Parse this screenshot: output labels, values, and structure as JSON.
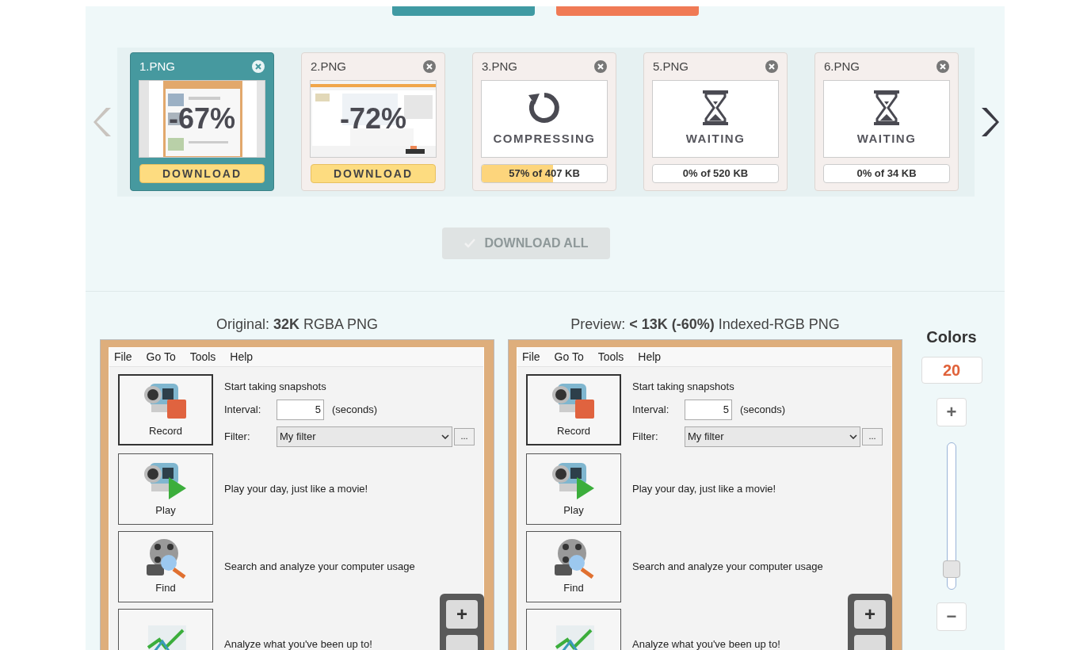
{
  "carousel": {
    "files": [
      {
        "name": "1.PNG",
        "kind": "done",
        "selected": true,
        "saving": "-67%",
        "action": "DOWNLOAD"
      },
      {
        "name": "2.PNG",
        "kind": "done",
        "selected": false,
        "saving": "-72%",
        "action": "DOWNLOAD"
      },
      {
        "name": "3.PNG",
        "kind": "compressing",
        "selected": false,
        "status": "COMPRESSING",
        "progress": "57% of 407 KB",
        "level": 0.57
      },
      {
        "name": "5.PNG",
        "kind": "waiting",
        "selected": false,
        "status": "WAITING",
        "progress": "0% of 520 KB",
        "level": 0
      },
      {
        "name": "6.PNG",
        "kind": "waiting",
        "selected": false,
        "status": "WAITING",
        "progress": "0% of 34 KB",
        "level": 0
      }
    ]
  },
  "download_all": {
    "label": "DOWNLOAD ALL",
    "disabled": true
  },
  "panes": [
    {
      "caption": "Original: **32K** RGBA PNG",
      "zoom_in": "+",
      "app": {
        "menu": [
          "File",
          "Go To",
          "Tools",
          "Help"
        ],
        "tools": [
          {
            "kind": "record",
            "label": "Record",
            "text": "Start taking snapshots"
          },
          {
            "kind": "play",
            "label": "Play",
            "text": "Play your day, just like a movie!"
          },
          {
            "kind": "find",
            "label": "Find",
            "text": "Search and analyze your computer usage"
          },
          {
            "kind": "chart",
            "text": "Analyze what you've been up to!"
          }
        ],
        "interval": {
          "label": "Interval:",
          "value": "5",
          "unit": "(seconds)"
        },
        "filter": {
          "label": "Filter:",
          "value": "My filter",
          "more": "..."
        }
      }
    },
    {
      "caption": "Preview: **< 13K (-60%)** Indexed-RGB PNG",
      "zoom_in": "+",
      "app": {
        "menu": [
          "File",
          "Go To",
          "Tools",
          "Help"
        ],
        "tools": [
          {
            "kind": "record",
            "label": "Record",
            "text": "Start taking snapshots"
          },
          {
            "kind": "play",
            "label": "Play",
            "text": "Play your day, just like a movie!"
          },
          {
            "kind": "find",
            "label": "Find",
            "text": "Search and analyze your computer usage"
          },
          {
            "kind": "chart",
            "text": "Analyze what you've been up to!"
          }
        ],
        "interval": {
          "label": "Interval:",
          "value": "5",
          "unit": "(seconds)"
        },
        "filter": {
          "label": "Filter:",
          "value": "My filter",
          "more": "..."
        }
      }
    }
  ],
  "colors": {
    "title": "Colors",
    "value": "20",
    "plus": "+",
    "minus": "−",
    "level": 0.08
  }
}
